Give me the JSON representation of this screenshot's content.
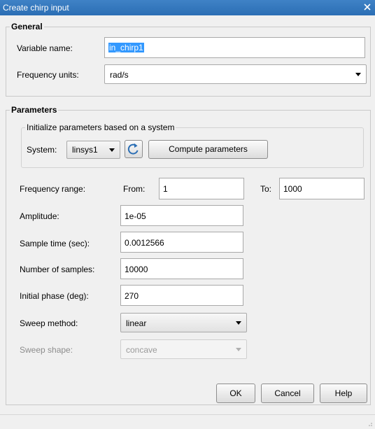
{
  "window": {
    "title": "Create chirp input"
  },
  "general": {
    "title": "General",
    "variable_name_label": "Variable name:",
    "variable_name_value": "in_chirp1",
    "frequency_units_label": "Frequency units:",
    "frequency_units_value": "rad/s"
  },
  "parameters": {
    "title": "Parameters",
    "init_group_title": "Initialize parameters based on a system",
    "system_label": "System:",
    "system_value": "linsys1",
    "refresh_icon": "refresh-icon",
    "compute_button": "Compute parameters",
    "frequency_range_label": "Frequency range:",
    "from_label": "From:",
    "from_value": "1",
    "to_label": "To:",
    "to_value": "1000",
    "amplitude_label": "Amplitude:",
    "amplitude_value": "1e-05",
    "sample_time_label": "Sample time (sec):",
    "sample_time_value": "0.0012566",
    "num_samples_label": "Number of samples:",
    "num_samples_value": "10000",
    "initial_phase_label": "Initial phase (deg):",
    "initial_phase_value": "270",
    "sweep_method_label": "Sweep method:",
    "sweep_method_value": "linear",
    "sweep_shape_label": "Sweep shape:",
    "sweep_shape_value": "concave"
  },
  "buttons": {
    "ok": "OK",
    "cancel": "Cancel",
    "help": "Help"
  },
  "colors": {
    "title_bar": "#2b6eb4",
    "selection": "#3399ff",
    "dialog_bg": "#f0f0f0"
  }
}
